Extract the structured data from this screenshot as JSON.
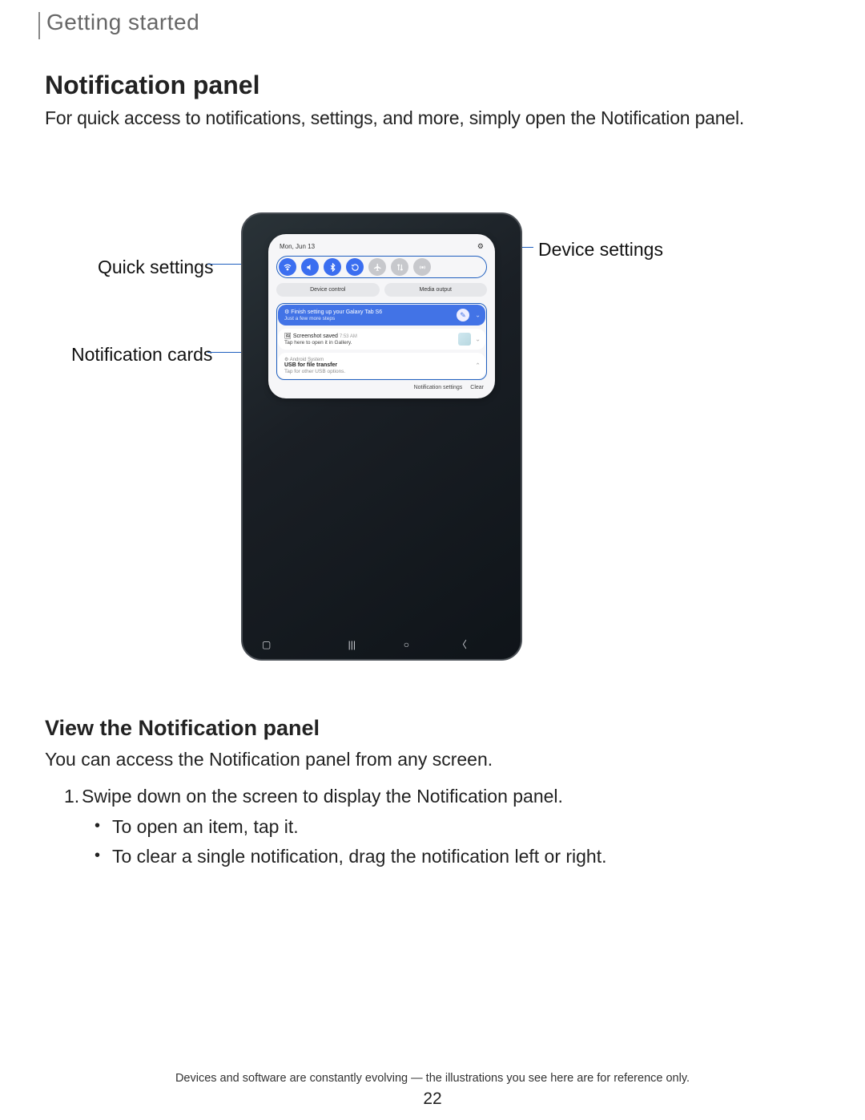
{
  "header": {
    "section": "Getting started"
  },
  "title": "Notification panel",
  "intro": "For quick access to notifications, settings, and more, simply open the Notification panel.",
  "callouts": {
    "quick_settings": "Quick settings",
    "notification_cards": "Notification cards",
    "device_settings": "Device settings"
  },
  "panel": {
    "date": "Mon, Jun 13",
    "pills": {
      "device_control": "Device control",
      "media_output": "Media output"
    },
    "notifications": [
      {
        "title": "Finish setting up your Galaxy Tab S6",
        "sub": "Just a few more steps"
      },
      {
        "title": "Screenshot saved",
        "time": "7:53 AM",
        "sub": "Tap here to open it in Gallery."
      },
      {
        "app": "Android System",
        "title": "USB for file transfer",
        "sub": "Tap for other USB options."
      }
    ],
    "footer": {
      "settings": "Notification settings",
      "clear": "Clear"
    }
  },
  "subheading": "View the Notification panel",
  "body2": "You can access the Notification panel from any screen.",
  "steps": {
    "item1": "Swipe down on the screen to display the Notification panel.",
    "sub1": "To open an item, tap it.",
    "sub2": "To clear a single notification, drag the notification left or right."
  },
  "footnote": "Devices and software are constantly evolving — the illustrations you see here are for reference only.",
  "page_number": "22"
}
